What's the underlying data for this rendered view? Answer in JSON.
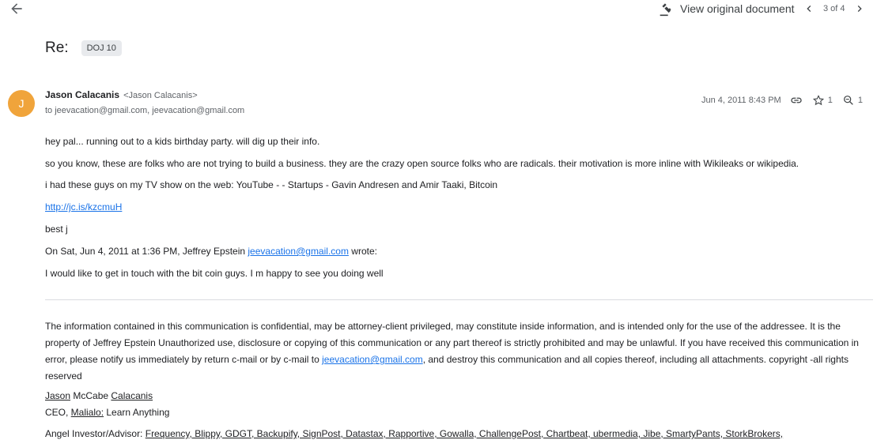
{
  "toolbar": {
    "view_original": "View original document",
    "pager": "3 of 4"
  },
  "subject": "Re:",
  "label": "DOJ 10",
  "sender": {
    "initial": "J",
    "name": "Jason Calacanis",
    "email": "<Jason Calacanis>",
    "recipients": "to jeevacation@gmail.com, jeevacation@gmail.com",
    "date": "Jun 4, 2011 8:43 PM",
    "star_count": "1",
    "zoom_count": "1"
  },
  "body": {
    "line1": "hey pal... running out to a kids birthday party. will dig up their info.",
    "line2": "so you know, these are folks who are not trying to build a business. they are the crazy open source folks who are radicals. their motivation is more inline with Wikileaks or wikipedia.",
    "line3": "i had these guys on my TV show on the web: YouTube - - Startups - Gavin Andresen and Amir Taaki, Bitcoin",
    "link": "http://jc.is/kzcmuH",
    "signoff": "best j",
    "quote_prefix": "On Sat, Jun 4, 2011 at 1:36 PM, Jeffrey Epstein ",
    "quote_email": "jeevacation@gmail.com",
    "quote_suffix": " wrote:",
    "quote_text": "I would like to get in touch with the bit coin guys. I m happy to see you doing well"
  },
  "disclaimer": {
    "part1": "The information contained in this communication is confidential, may be attorney-client privileged, may constitute inside information, and is intended only for the use of the addressee. It is the property of Jeffrey Epstein Unauthorized use, disclosure or copying of this communication or any part thereof is strictly prohibited and may be unlawful. If you have received this communication in error, please notify us immediately by return c-mail or by c-mail to ",
    "email": "jeevacation@gmail.com",
    "part2": ", and destroy this communication and all copies thereof, including all attachments. copyright -all rights reserved"
  },
  "signature": {
    "first": "Jason",
    "middle": " McCabe ",
    "last": "Calacanis",
    "ceo_prefix": "CEO, ",
    "company": "Malialo:",
    "tagline": " Learn Anything",
    "investor_prefix": "Angel Investor/Advisor: ",
    "investments": "Frequency, Blippy, GDGT, Backupify, SignPost, Datastax, Rapportive, Gowalla, ChallengePost, Chartbeat, ubermedia, Jibe, SmartyPants, StorkBrokers,"
  }
}
